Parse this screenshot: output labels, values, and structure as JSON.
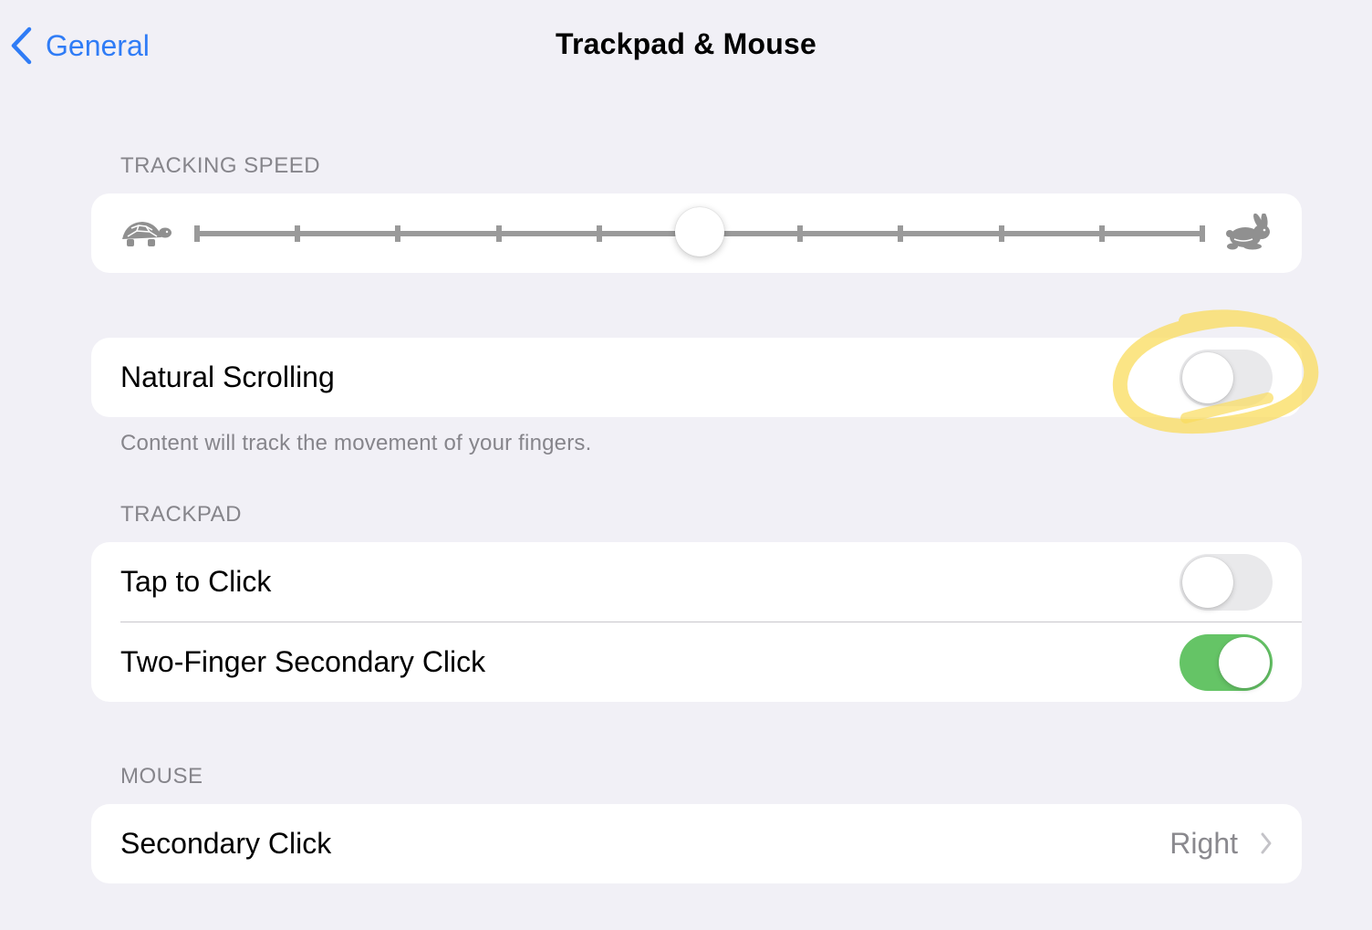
{
  "nav": {
    "back_label": "General",
    "title": "Trackpad & Mouse"
  },
  "tracking_speed": {
    "header": "TRACKING SPEED",
    "min_icon": "turtle-icon",
    "max_icon": "rabbit-icon",
    "value": 0.5,
    "steps": 10
  },
  "natural_scrolling": {
    "label": "Natural Scrolling",
    "enabled": false,
    "note": "Content will track the movement of your fingers."
  },
  "trackpad": {
    "header": "TRACKPAD",
    "items": [
      {
        "label": "Tap to Click",
        "enabled": false
      },
      {
        "label": "Two-Finger Secondary Click",
        "enabled": true
      }
    ]
  },
  "mouse": {
    "header": "MOUSE",
    "secondary_click": {
      "label": "Secondary Click",
      "value": "Right"
    }
  },
  "colors": {
    "accent": "#2f7cf6",
    "toggle_on": "#65c466",
    "toggle_off": "#e9e9eb",
    "annotation": "#f9dc5c"
  }
}
